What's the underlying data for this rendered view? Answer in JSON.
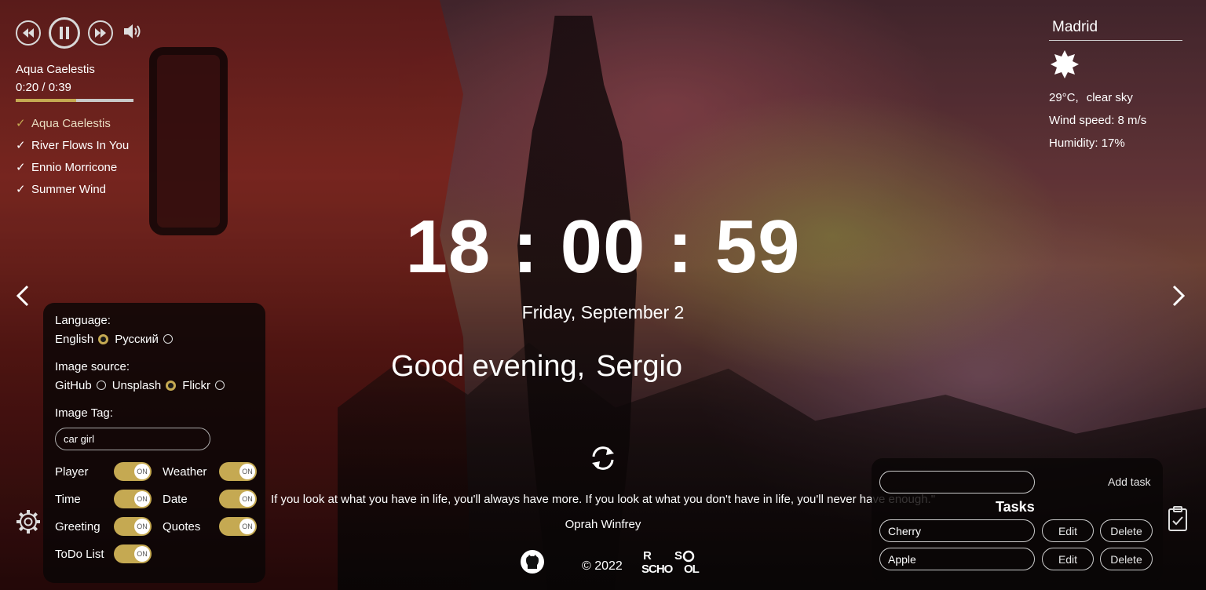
{
  "player": {
    "track_title": "Aqua Caelestis",
    "time_display": "0:20 / 0:39",
    "progress_fraction": 0.51,
    "controls": [
      "rewind-icon",
      "pause-icon",
      "fast-forward-icon",
      "volume-icon"
    ],
    "playlist": [
      {
        "title": "Aqua Caelestis",
        "active": true
      },
      {
        "title": "River Flows In You",
        "active": false
      },
      {
        "title": "Ennio Morricone",
        "active": false
      },
      {
        "title": "Summer Wind",
        "active": false
      }
    ],
    "check_glyph": "✓"
  },
  "weather": {
    "city": "Madrid",
    "icon": "clear-sky-sun-icon",
    "temperature": "29°C,",
    "description": "clear sky",
    "wind": "Wind speed: 8 m/s",
    "humidity": "Humidity: 17%"
  },
  "clock": {
    "time": "18 : 00 : 59",
    "date": "Friday, September 2"
  },
  "greeting": {
    "text": "Good evening,",
    "name": "Sergio"
  },
  "settings": {
    "language_label": "Language:",
    "language_options": [
      {
        "label": "English",
        "selected": true
      },
      {
        "label": "Русский",
        "selected": false
      }
    ],
    "image_source_label": "Image source:",
    "image_source_options": [
      {
        "label": "GitHub",
        "selected": false
      },
      {
        "label": "Unsplash",
        "selected": true
      },
      {
        "label": "Flickr",
        "selected": false
      }
    ],
    "image_tag_label": "Image Tag:",
    "image_tag_value": "car girl",
    "toggles": [
      {
        "label": "Player",
        "state": "ON"
      },
      {
        "label": "Weather",
        "state": "ON"
      },
      {
        "label": "Time",
        "state": "ON"
      },
      {
        "label": "Date",
        "state": "ON"
      },
      {
        "label": "Greeting",
        "state": "ON"
      },
      {
        "label": "Quotes",
        "state": "ON"
      },
      {
        "label": "ToDo List",
        "state": "ON"
      }
    ]
  },
  "quote": {
    "text": "If you look at what you have in life, you'll always have more. If you look at what you don't have in life, you'll never have enough.\"",
    "author": "Oprah Winfrey"
  },
  "footer": {
    "year": "© 2022",
    "school_logo_text": "RS SCHOOL"
  },
  "todo": {
    "input_value": "",
    "add_label": "Add task",
    "title": "Tasks",
    "tasks": [
      {
        "text": "Cherry",
        "edit_label": "Edit",
        "delete_label": "Delete"
      },
      {
        "text": "Apple",
        "edit_label": "Edit",
        "delete_label": "Delete"
      }
    ]
  },
  "colors": {
    "accent": "#c5a952",
    "panel_bg": "#0a0606"
  }
}
